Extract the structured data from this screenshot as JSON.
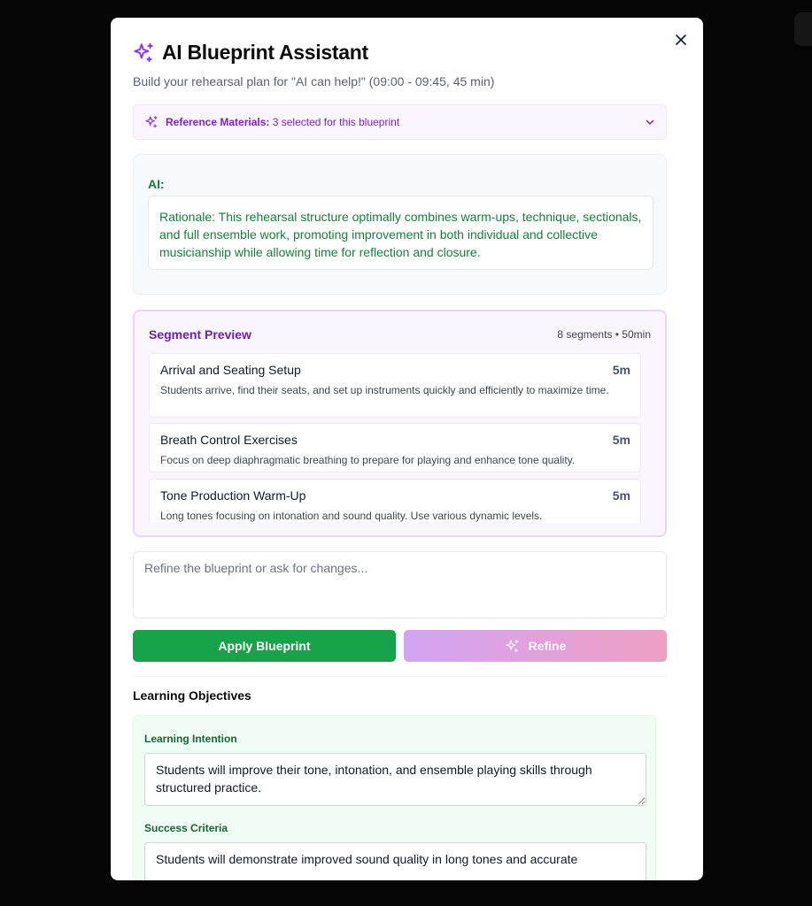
{
  "modal": {
    "title": "AI Blueprint Assistant",
    "subtitle": "Build your rehearsal plan for \"AI can help!\" (09:00 - 09:45, 45 min)",
    "close_label": "Close"
  },
  "reference": {
    "label": "Reference Materials:",
    "summary": "3 selected for this blueprint"
  },
  "ai_message": {
    "speaker": "AI:",
    "text": "Rationale: This rehearsal structure optimally combines warm-ups, technique, sectionals, and full ensemble work, promoting improvement in both individual and collective musicianship while allowing time for reflection and closure."
  },
  "segment_preview": {
    "title": "Segment Preview",
    "meta": "8 segments • 50min",
    "segments": [
      {
        "title": "Arrival and Seating Setup",
        "duration": "5m",
        "description": "Students arrive, find their seats, and set up instruments quickly and efficiently to maximize time."
      },
      {
        "title": "Breath Control Exercises",
        "duration": "5m",
        "description": "Focus on deep diaphragmatic breathing to prepare for playing and enhance tone quality."
      },
      {
        "title": "Tone Production Warm-Up",
        "duration": "5m",
        "description": "Long tones focusing on intonation and sound quality. Use various dynamic levels."
      }
    ]
  },
  "refine": {
    "placeholder": "Refine the blueprint or ask for changes...",
    "value": ""
  },
  "actions": {
    "apply_label": "Apply Blueprint",
    "refine_label": "Refine"
  },
  "learning_objectives": {
    "title": "Learning Objectives",
    "intention_label": "Learning Intention",
    "intention_value": "Students will improve their tone, intonation, and ensemble playing skills through structured practice.",
    "criteria_label": "Success Criteria",
    "criteria_value": "Students will demonstrate improved sound quality in long tones and accurate"
  },
  "colors": {
    "accent_purple": "#9333ea",
    "success_green": "#16a34a",
    "ai_text_green": "#15803d"
  },
  "icons": {
    "title": "sparkles-icon",
    "reference": "sparkles-icon",
    "refine": "sparkles-icon",
    "close": "close-icon",
    "expand": "chevron-down-icon"
  }
}
